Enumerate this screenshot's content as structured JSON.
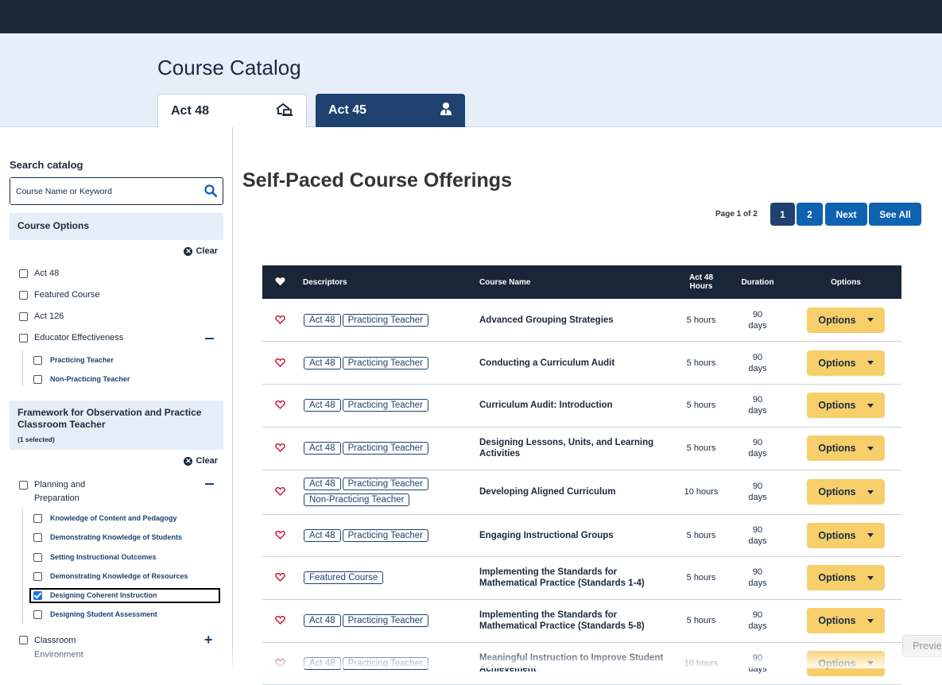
{
  "header": {
    "title": "Course Catalog"
  },
  "tabs": [
    {
      "label": "Act 48",
      "icon": "house-laptop-icon"
    },
    {
      "label": "Act 45",
      "icon": "user-tie-icon"
    }
  ],
  "sidebar": {
    "search_label": "Search catalog",
    "search_placeholder": "Course Name or Keyword",
    "course_options": {
      "title": "Course Options",
      "clear_label": "Clear",
      "items": [
        {
          "label": "Act 48",
          "checked": false
        },
        {
          "label": "Featured Course",
          "checked": false
        },
        {
          "label": "Act 126",
          "checked": false
        },
        {
          "label": "Educator Effectiveness",
          "checked": false
        }
      ],
      "sub_items": [
        {
          "label": "Practicing Teacher",
          "checked": false
        },
        {
          "label": "Non-Practicing Teacher",
          "checked": false
        }
      ]
    },
    "framework": {
      "title": "Framework for Observation and Practice Classroom Teacher",
      "selected_count": "(1 selected)",
      "clear_label": "Clear",
      "planning": {
        "label": "Planning and Preparation",
        "checked": false
      },
      "planning_sub": [
        {
          "label": "Knowledge of Content and Pedagogy",
          "checked": false
        },
        {
          "label": "Demonstrating Knowledge of Students",
          "checked": false
        },
        {
          "label": "Setting Instructional Outcomes",
          "checked": false
        },
        {
          "label": "Demonstrating Knowledge of Resources",
          "checked": false
        },
        {
          "label": "Designing Coherent Instruction",
          "checked": true
        },
        {
          "label": "Designing Student Assessment",
          "checked": false
        }
      ],
      "classroom": {
        "label": "Classroom Environment",
        "checked": false
      }
    }
  },
  "main": {
    "title": "Self-Paced Course Offerings",
    "pager": {
      "label": "Page 1 of 2",
      "pages": [
        "1",
        "2"
      ],
      "next": "Next",
      "see_all": "See All"
    },
    "table": {
      "headers": {
        "descriptors": "Descriptors",
        "course_name": "Course Name",
        "hours": "Act 48 Hours",
        "duration": "Duration",
        "options": "Options"
      },
      "rows": [
        {
          "tags": [
            "Act 48",
            "Practicing Teacher"
          ],
          "name": "Advanced Grouping Strategies",
          "hours": "5 hours",
          "duration": "90 days",
          "option": "Options"
        },
        {
          "tags": [
            "Act 48",
            "Practicing Teacher"
          ],
          "name": "Conducting a Curriculum Audit",
          "hours": "5 hours",
          "duration": "90 days",
          "option": "Options"
        },
        {
          "tags": [
            "Act 48",
            "Practicing Teacher"
          ],
          "name": "Curriculum Audit: Introduction",
          "hours": "5 hours",
          "duration": "90 days",
          "option": "Options"
        },
        {
          "tags": [
            "Act 48",
            "Practicing Teacher"
          ],
          "name": "Designing Lessons, Units, and Learning Activities",
          "hours": "5 hours",
          "duration": "90 days",
          "option": "Options"
        },
        {
          "tags": [
            "Act 48",
            "Practicing Teacher",
            "Non-Practicing Teacher"
          ],
          "name": "Developing Aligned Curriculum",
          "hours": "10 hours",
          "duration": "90 days",
          "option": "Options"
        },
        {
          "tags": [
            "Act 48",
            "Practicing Teacher"
          ],
          "name": "Engaging Instructional Groups",
          "hours": "5 hours",
          "duration": "90 days",
          "option": "Options"
        },
        {
          "tags": [
            "Featured Course"
          ],
          "name": "Implementing the Standards for Mathematical Practice (Standards 1-4)",
          "hours": "5 hours",
          "duration": "90 days",
          "option": "Options"
        },
        {
          "tags": [
            "Act 48",
            "Practicing Teacher"
          ],
          "name": "Implementing the Standards for Mathematical Practice (Standards 5-8)",
          "hours": "5 hours",
          "duration": "90 days",
          "option": "Options"
        },
        {
          "tags": [
            "Act 48",
            "Practicing Teacher"
          ],
          "name": "Meaningful Instruction to Improve Student Achievement",
          "hours": "10 hours",
          "duration": "90 days",
          "option": "Options"
        }
      ]
    }
  },
  "preview_label": "Previe",
  "colors": {
    "navy": "#182638",
    "accent": "#1e4170",
    "button_blue": "#0f62b0",
    "options_yellow": "#f6cf6b",
    "heart_red": "#c8102e",
    "light_bg": "#e6eff8"
  }
}
